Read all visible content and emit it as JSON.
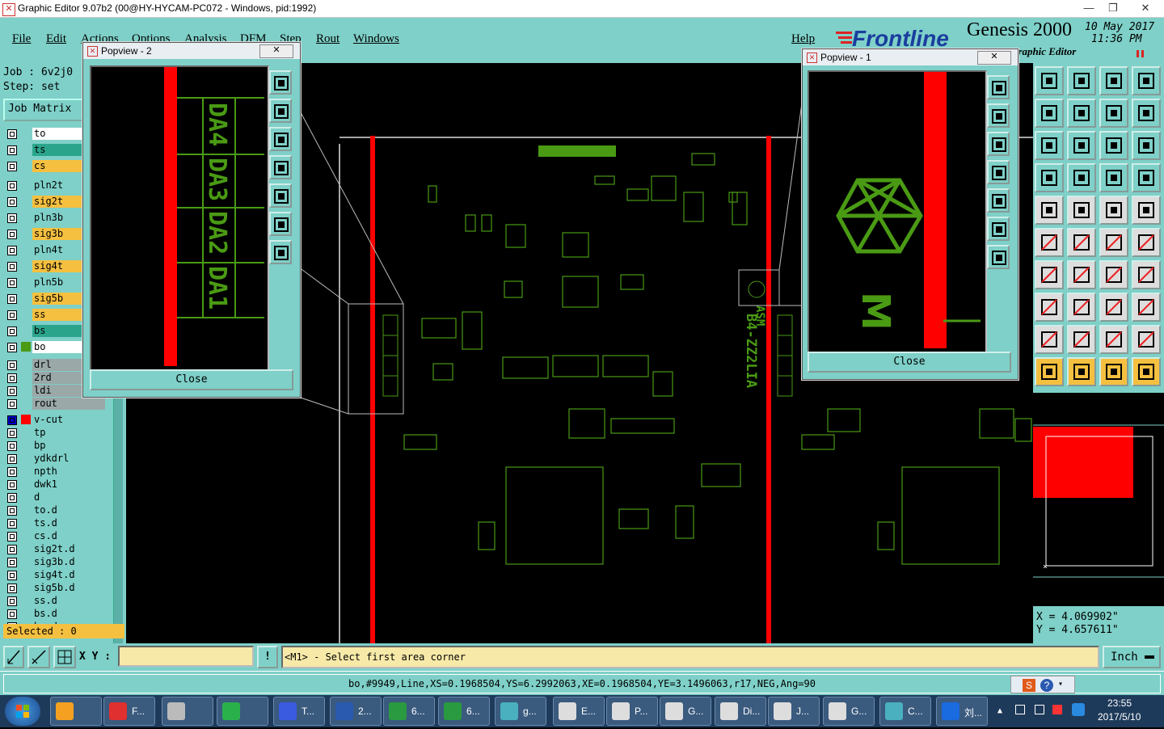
{
  "window": {
    "title": "Graphic Editor 9.07b2 (00@HY-HYCAM-PC072 - Windows, pid:1992)"
  },
  "menu": [
    "File",
    "Edit",
    "Actions",
    "Options",
    "Analysis",
    "DFM",
    "Step",
    "Rout",
    "Windows",
    "Help"
  ],
  "logo": {
    "brand": "Frontline",
    "product": "Genesis 2000",
    "date": "10 May 2017",
    "time": "11:36 PM",
    "subtitle": "Graphic Editor"
  },
  "job_info": {
    "job": "Job : 6v2j0",
    "step": "Step: set",
    "job_matrix": "Job Matrix"
  },
  "layers": [
    {
      "name": "to",
      "color": "#ffffff"
    },
    {
      "name": "ts",
      "color": "#2aa58c"
    },
    {
      "name": "cs",
      "color": "#f5c040"
    },
    {
      "name": "pln2t",
      "color": "#7ed0c8"
    },
    {
      "name": "sig2t",
      "color": "#f5c040"
    },
    {
      "name": "pln3b",
      "color": "#7ed0c8"
    },
    {
      "name": "sig3b",
      "color": "#f5c040"
    },
    {
      "name": "pln4t",
      "color": "#7ed0c8"
    },
    {
      "name": "sig4t",
      "color": "#f5c040"
    },
    {
      "name": "pln5b",
      "color": "#7ed0c8"
    },
    {
      "name": "sig5b",
      "color": "#f5c040"
    },
    {
      "name": "ss",
      "color": "#f5c040"
    },
    {
      "name": "bs",
      "color": "#2aa58c"
    },
    {
      "name": "bo",
      "color": "#ffffff"
    },
    {
      "name": "drl",
      "color": "#9aa8a8"
    },
    {
      "name": "2rd",
      "color": "#9aa8a8"
    },
    {
      "name": "ldi",
      "color": "#9aa8a8"
    },
    {
      "name": "rout",
      "color": "#9aa8a8"
    },
    {
      "name": "v-cut",
      "color": "#7ed0c8"
    },
    {
      "name": "tp",
      "color": "#7ed0c8"
    },
    {
      "name": "bp",
      "color": "#7ed0c8"
    },
    {
      "name": "ydkdrl",
      "color": "#7ed0c8"
    },
    {
      "name": "npth",
      "color": "#7ed0c8"
    },
    {
      "name": "dwk1",
      "color": "#7ed0c8"
    },
    {
      "name": "d",
      "color": "#7ed0c8"
    },
    {
      "name": "to.d",
      "color": "#7ed0c8"
    },
    {
      "name": "ts.d",
      "color": "#7ed0c8"
    },
    {
      "name": "cs.d",
      "color": "#7ed0c8"
    },
    {
      "name": "sig2t.d",
      "color": "#7ed0c8"
    },
    {
      "name": "sig3b.d",
      "color": "#7ed0c8"
    },
    {
      "name": "sig4t.d",
      "color": "#7ed0c8"
    },
    {
      "name": "sig5b.d",
      "color": "#7ed0c8"
    },
    {
      "name": "ss.d",
      "color": "#7ed0c8"
    },
    {
      "name": "bs.d",
      "color": "#7ed0c8"
    },
    {
      "name": "bo.d",
      "color": "#7ed0c8"
    }
  ],
  "selected": "Selected : 0",
  "popview1": {
    "title": "Popview - 1",
    "close": "Close"
  },
  "popview2": {
    "title": "Popview - 2",
    "close": "Close",
    "labels": [
      "DA1",
      "DA2",
      "DA3",
      "DA4"
    ]
  },
  "board": {
    "marking": "B4-ZZ2LIA",
    "marking2": "ASM"
  },
  "coords": {
    "x": "X = 4.069902\"",
    "y": "Y = 4.657611\""
  },
  "cmd": {
    "xy_label": "X Y :",
    "xy_value": "",
    "prompt": "<M1> - Select first area corner",
    "units": "Inch"
  },
  "status": "bo,#9949,Line,XS=0.1968504,YS=6.2992063,XE=0.1968504,YE=3.1496063,r17,NEG,Ang=90",
  "taskbar": {
    "items": [
      "F...",
      "",
      "",
      "T...",
      "2...",
      "6...",
      "6...",
      "g...",
      "E...",
      "P...",
      "G...",
      "Di...",
      "J...",
      "G...",
      "C...",
      "刘..."
    ],
    "clock_time": "23:55",
    "clock_date": "2017/5/10"
  }
}
